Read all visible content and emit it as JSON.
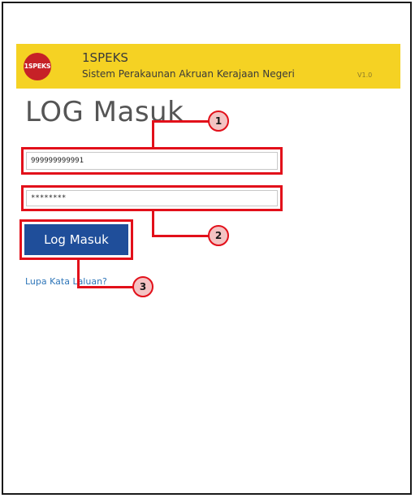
{
  "header": {
    "logo_text": "1SPEKS",
    "app_name": "1SPEKS",
    "app_description": "Sistem Perakaunan Akruan Kerajaan Negeri",
    "version": "V1.0"
  },
  "login": {
    "title": "LOG Masuk",
    "username_value": "999999999991",
    "password_value": "********",
    "submit_label": "Log Masuk",
    "forgot_link": "Lupa Kata Laluan?"
  },
  "callouts": {
    "badge_1": "1",
    "badge_2": "2",
    "badge_3": "3"
  },
  "colors": {
    "header_bg": "#f5d223",
    "button_bg": "#1f4e9a",
    "highlight": "#e2101a",
    "link": "#2f76b9"
  }
}
